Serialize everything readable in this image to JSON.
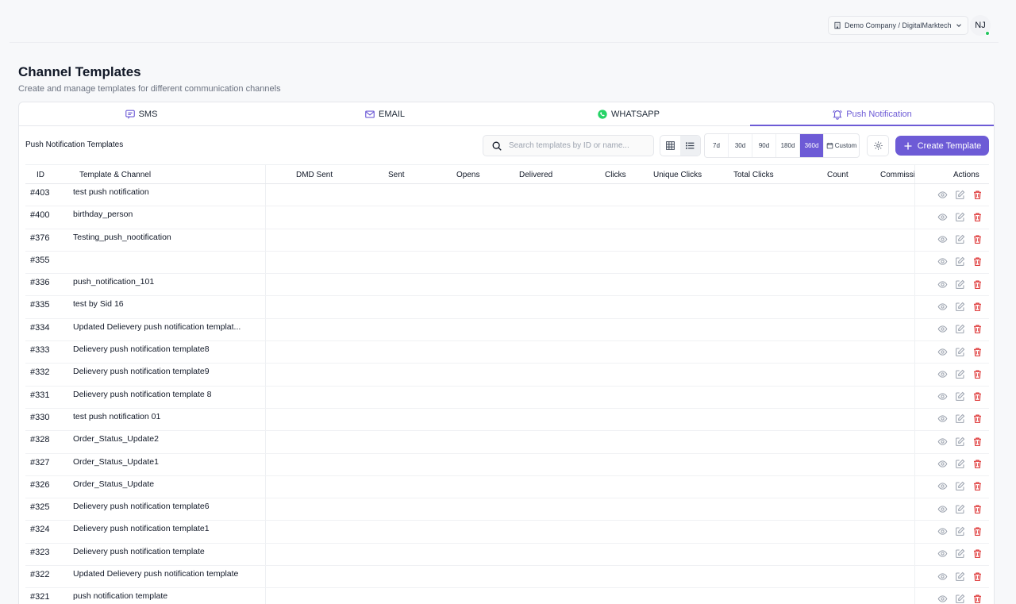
{
  "header": {
    "company": "Demo Company / DigitalMarktech",
    "avatar_initials": "NJ"
  },
  "page": {
    "title": "Channel Templates",
    "subtitle": "Create and manage templates for different communication channels"
  },
  "tabs": [
    {
      "label": "SMS",
      "icon": "sms-icon"
    },
    {
      "label": "EMAIL",
      "icon": "email-icon"
    },
    {
      "label": "WHATSAPP",
      "icon": "whatsapp-icon"
    },
    {
      "label": "Push Notification",
      "icon": "bell-icon",
      "active": true
    }
  ],
  "toolbar": {
    "section_label": "Push Notification Templates",
    "search_placeholder": "Search templates by ID or name...",
    "ranges": [
      "7d",
      "30d",
      "90d",
      "180d",
      "360d"
    ],
    "active_range": "360d",
    "custom_label": "Custom",
    "create_label": "Create Template"
  },
  "table": {
    "columns": [
      "ID",
      "Template & Channel",
      "DMD Sent",
      "Sent",
      "Opens",
      "Delivered",
      "Clicks",
      "Unique Clicks",
      "Total Clicks",
      "Count",
      "Commissi",
      "Actions"
    ],
    "rows": [
      {
        "id": "#403",
        "name": "test push notification"
      },
      {
        "id": "#400",
        "name": "birthday_person"
      },
      {
        "id": "#376",
        "name": "Testing_push_nootification"
      },
      {
        "id": "#355",
        "name": ""
      },
      {
        "id": "#336",
        "name": "push_notification_101"
      },
      {
        "id": "#335",
        "name": "test by Sid 16"
      },
      {
        "id": "#334",
        "name": "Updated Delievery push notification templat..."
      },
      {
        "id": "#333",
        "name": "Delievery push notification template8"
      },
      {
        "id": "#332",
        "name": "Delievery push notification template9"
      },
      {
        "id": "#331",
        "name": "Delievery push notification template 8"
      },
      {
        "id": "#330",
        "name": "test push notification 01"
      },
      {
        "id": "#328",
        "name": "Order_Status_Update2"
      },
      {
        "id": "#327",
        "name": "Order_Status_Update1"
      },
      {
        "id": "#326",
        "name": "Order_Status_Update"
      },
      {
        "id": "#325",
        "name": "Delievery push notification template6"
      },
      {
        "id": "#324",
        "name": "Delievery push notification template1"
      },
      {
        "id": "#323",
        "name": "Delievery push notification template"
      },
      {
        "id": "#322",
        "name": "Updated Delievery push notification template"
      },
      {
        "id": "#321",
        "name": "push notification template"
      }
    ]
  },
  "colors": {
    "accent": "#6d5bd6",
    "delete": "#dc2626",
    "online": "#22c55e"
  }
}
